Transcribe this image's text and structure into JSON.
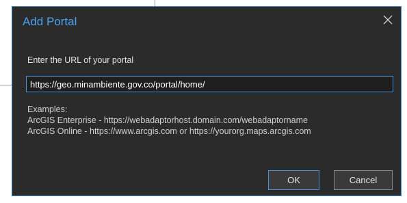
{
  "dialog": {
    "title": "Add Portal",
    "close_icon": "close-icon",
    "prompt": "Enter the URL of your portal",
    "url_value": "https://geo.minambiente.gov.co/portal/home/",
    "examples": {
      "heading": "Examples:",
      "enterprise": "ArcGIS Enterprise - https://webadaptorhost.domain.com/webadaptorname",
      "online": "ArcGIS Online - https://www.arcgis.com or https://yourorg.maps.arcgis.com"
    },
    "ok_label": "OK",
    "cancel_label": "Cancel"
  },
  "colors": {
    "dialog_bg": "#2b2b2b",
    "accent": "#4aa3f0",
    "border_accent": "#4a90d9"
  }
}
